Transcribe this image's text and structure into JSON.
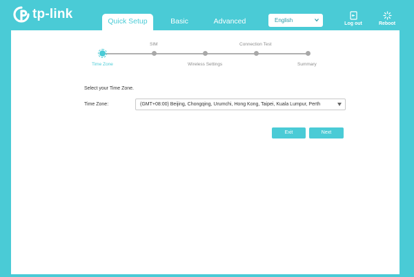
{
  "brand": {
    "name": "tp-link",
    "accent_color": "#4acbd6"
  },
  "nav": {
    "tabs": [
      {
        "label": "Quick Setup",
        "active": true
      },
      {
        "label": "Basic",
        "active": false
      },
      {
        "label": "Advanced",
        "active": false
      }
    ]
  },
  "language": {
    "selected": "English"
  },
  "header_buttons": {
    "logout_label": "Log out",
    "reboot_label": "Reboot"
  },
  "wizard": {
    "steps": [
      {
        "label": "Time Zone",
        "active": true
      },
      {
        "label": "SIM",
        "active": false
      },
      {
        "label": "Wireless Settings",
        "active": false
      },
      {
        "label": "Connection Test",
        "active": false
      },
      {
        "label": "Summary",
        "active": false
      }
    ]
  },
  "form": {
    "section_title": "Select your Time Zone.",
    "timezone_label": "Time Zone:",
    "timezone_value": "(GMT+08:00) Beijing, Chongqing, Urumchi, Hong Kong, Taipei, Kuala Lumpur, Perth"
  },
  "actions": {
    "exit_label": "Exit",
    "next_label": "Next"
  }
}
